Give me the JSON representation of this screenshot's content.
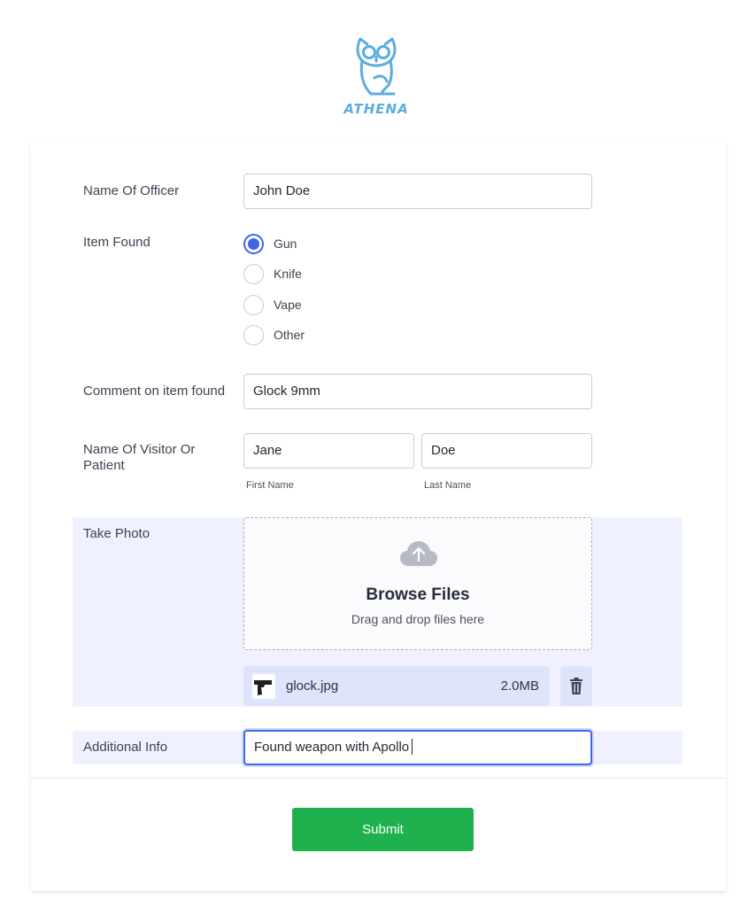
{
  "brand": {
    "name": "ATHENA",
    "logo_icon": "owl-icon",
    "color": "#5aade0"
  },
  "form": {
    "officer": {
      "label": "Name Of Officer",
      "value": "John Doe"
    },
    "item_found": {
      "label": "Item Found",
      "options": [
        {
          "label": "Gun",
          "selected": true
        },
        {
          "label": "Knife",
          "selected": false
        },
        {
          "label": "Vape",
          "selected": false
        },
        {
          "label": "Other",
          "selected": false
        }
      ]
    },
    "comment": {
      "label": "Comment on item found",
      "value": "Glock 9mm"
    },
    "visitor": {
      "label": "Name Of Visitor Or Patient",
      "first": {
        "value": "Jane",
        "sublabel": "First Name"
      },
      "last": {
        "value": "Doe",
        "sublabel": "Last Name"
      }
    },
    "photo": {
      "label": "Take Photo",
      "dropzone_title": "Browse Files",
      "dropzone_subtitle": "Drag and drop files here",
      "file": {
        "name": "glock.jpg",
        "size": "2.0MB"
      }
    },
    "additional_info": {
      "label": "Additional Info",
      "value": "Found weapon with Apollo"
    },
    "submit_label": "Submit"
  },
  "colors": {
    "accent": "#3f64ee",
    "submit": "#1fb14d",
    "band": "#eff2fe"
  }
}
